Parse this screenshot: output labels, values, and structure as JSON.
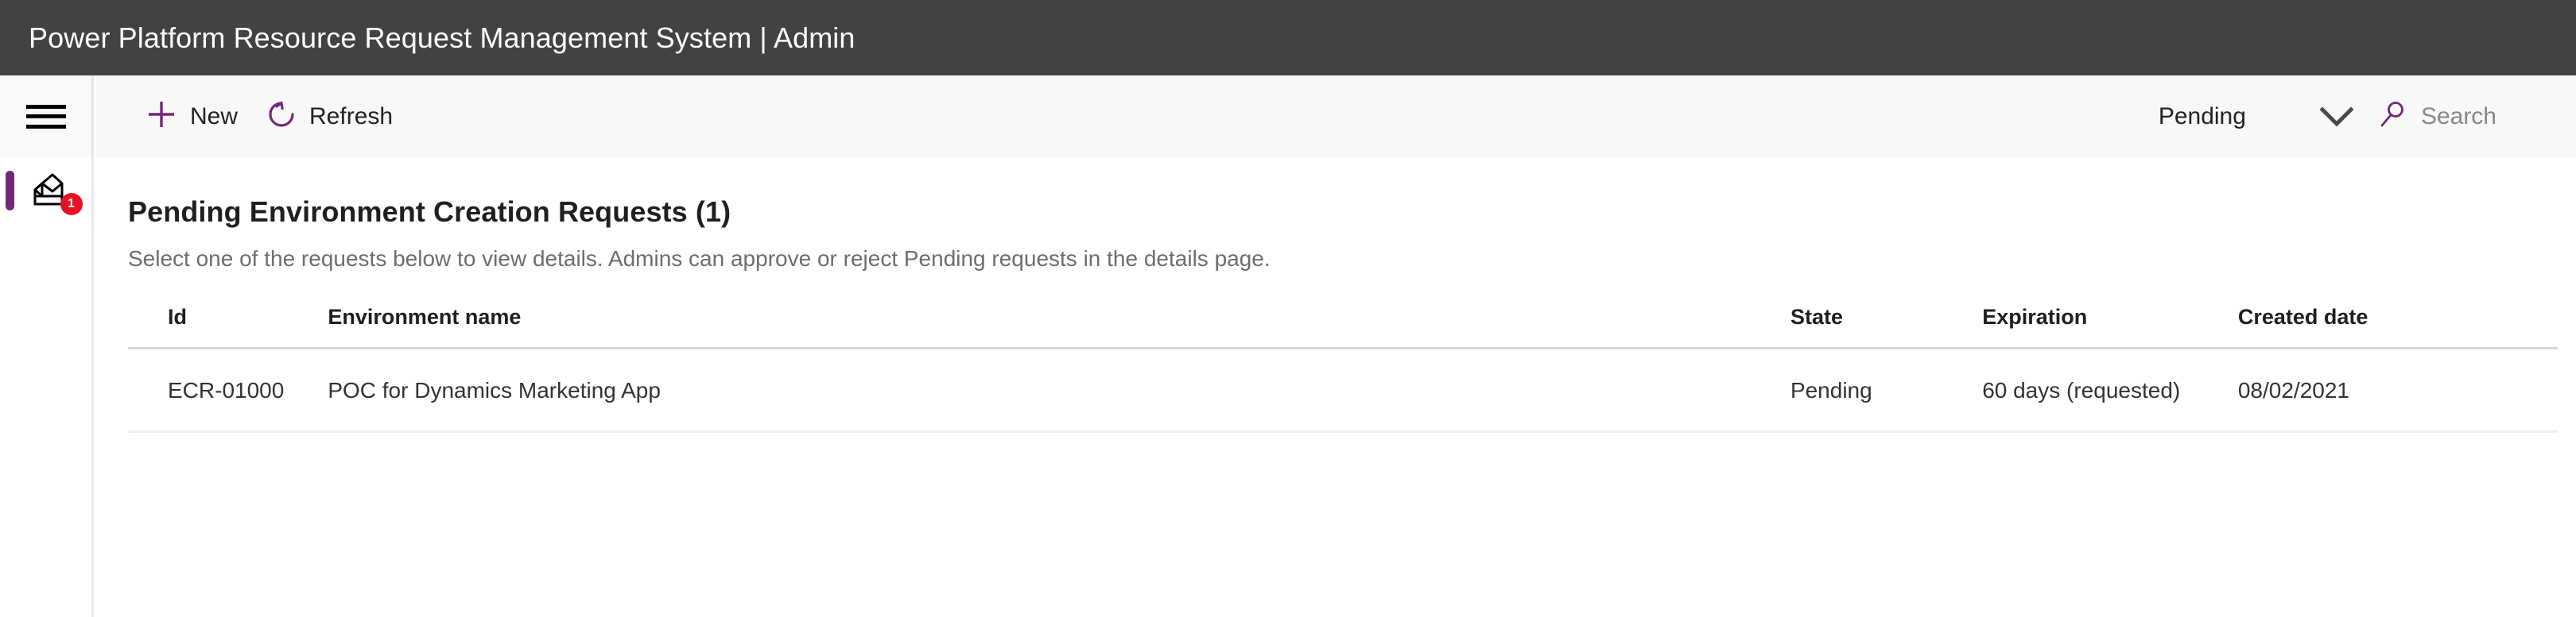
{
  "titlebar": {
    "title": "Power Platform Resource Request Management System | Admin"
  },
  "colors": {
    "titlebar_bg": "#424242",
    "accent": "#742774",
    "badge": "#e81123",
    "commandbar_bg": "#f8f8f8"
  },
  "rail": {
    "hamburger_icon": "hamburger-menu-icon",
    "items": [
      {
        "icon": "inbox-tray-icon",
        "badge_count": "1",
        "active": true
      }
    ]
  },
  "commandbar": {
    "new_label": "New",
    "new_icon": "plus-icon",
    "refresh_label": "Refresh",
    "refresh_icon": "refresh-icon",
    "filter_value": "Pending",
    "chevron_icon": "chevron-down-icon",
    "search_icon": "search-icon",
    "search_placeholder": "Search",
    "search_value": ""
  },
  "main": {
    "title": "Pending Environment Creation Requests (1)",
    "subtitle": "Select one of the requests below to view details. Admins can approve or reject Pending requests in the details page.",
    "table": {
      "columns": [
        "Id",
        "Environment name",
        "State",
        "Expiration",
        "Created date"
      ],
      "rows": [
        {
          "id": "ECR-01000",
          "environment_name": "POC for Dynamics Marketing App",
          "state": "Pending",
          "expiration": "60 days (requested)",
          "created_date": "08/02/2021"
        }
      ]
    }
  }
}
